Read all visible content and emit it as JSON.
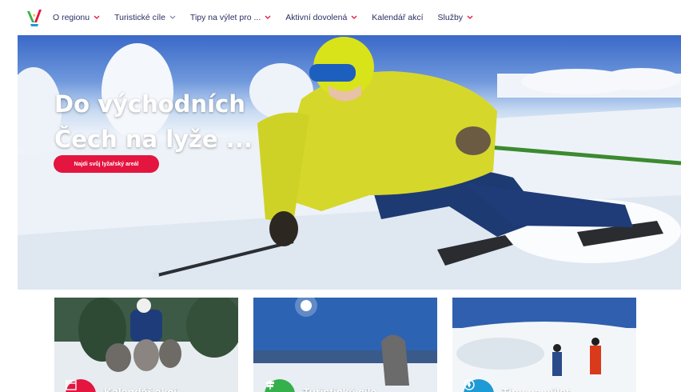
{
  "nav": {
    "logo": "region-logo",
    "items": [
      {
        "label": "O regionu"
      },
      {
        "label": "Turistické cíle"
      },
      {
        "label": "Tipy na výlet pro ..."
      },
      {
        "label": "Aktivní dovolená"
      },
      {
        "label": "Kalendář akcí"
      },
      {
        "label": "Služby"
      }
    ]
  },
  "hero": {
    "title_line1": "Do východních",
    "title_line2": "Čech na lyže ...",
    "button": "Najdi svůj lyžařský areál"
  },
  "cards": [
    {
      "label": "Kalendář akcí",
      "icon": "calendar-icon",
      "color": "#e4153f"
    },
    {
      "label": "Turistické cíle",
      "icon": "sign-icon",
      "color": "#35b04a"
    },
    {
      "label": "Tipy na výlet",
      "icon": "compass-icon",
      "color": "#1e9ad6"
    }
  ],
  "colors": {
    "accent": "#e4153f",
    "nav_text": "#2b2f63"
  }
}
